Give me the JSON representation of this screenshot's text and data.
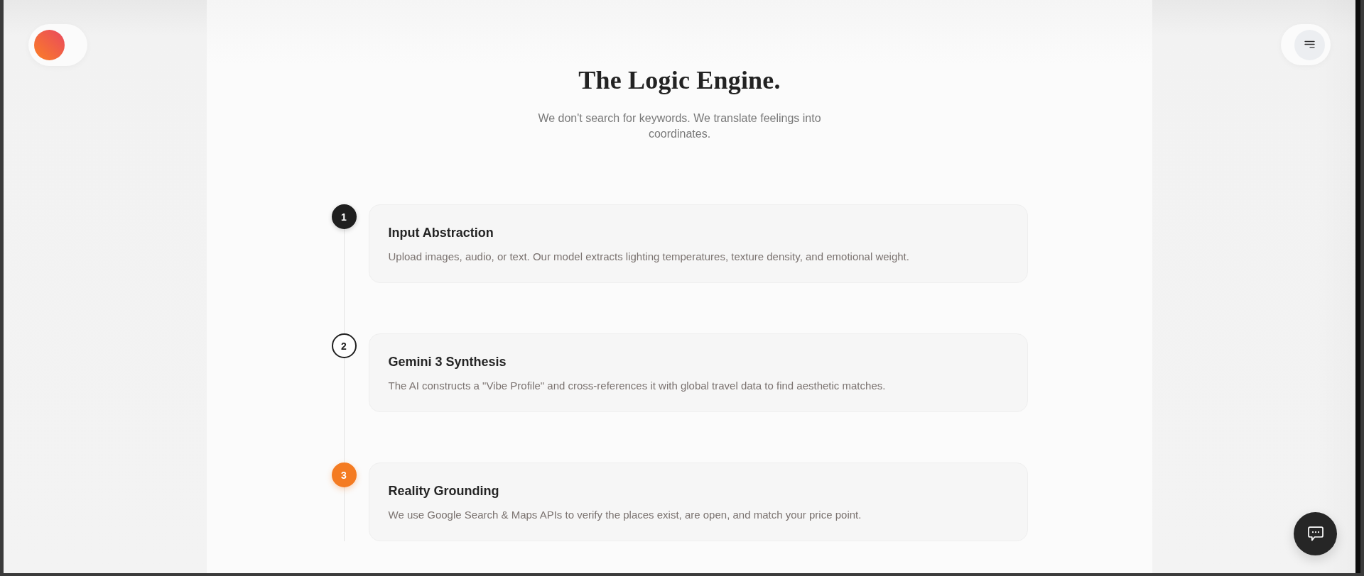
{
  "section": {
    "title": "The Logic Engine.",
    "subtitle": "We don't search for keywords. We translate feelings into coordinates."
  },
  "steps": [
    {
      "number": "1",
      "kind": "filled",
      "title": "Input Abstraction",
      "description": "Upload images, audio, or text. Our model extracts lighting temperatures, texture density, and emotional weight."
    },
    {
      "number": "2",
      "kind": "outline",
      "title": "Gemini 3 Synthesis",
      "description": "The AI constructs a \"Vibe Profile\" and cross-references it with global travel data to find aesthetic matches."
    },
    {
      "number": "3",
      "kind": "accent",
      "title": "Reality Grounding",
      "description": "We use Google Search & Maps APIs to verify the places exist, are open, and match your price point."
    }
  ]
}
